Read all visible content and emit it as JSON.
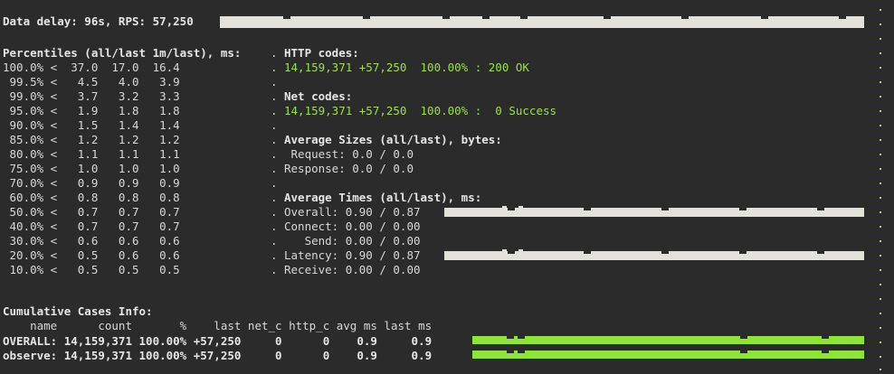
{
  "header": {
    "status_line": "Data delay: 96s, RPS: 57,250"
  },
  "percentiles": {
    "title": "Percentiles (all/last 1m/last), ms:",
    "rows": [
      "100.0% <  37.0  17.0  16.4",
      " 99.5% <   4.5   4.0   3.9",
      " 99.0% <   3.7   3.2   3.3",
      " 95.0% <   1.9   1.8   1.8",
      " 90.0% <   1.5   1.4   1.4",
      " 85.0% <   1.2   1.2   1.2",
      " 80.0% <   1.1   1.1   1.1",
      " 75.0% <   1.0   1.0   1.0",
      " 70.0% <   0.9   0.9   0.9",
      " 60.0% <   0.8   0.8   0.8",
      " 50.0% <   0.7   0.7   0.7",
      " 40.0% <   0.7   0.7   0.7",
      " 30.0% <   0.6   0.6   0.6",
      " 20.0% <   0.5   0.6   0.6",
      " 10.0% <   0.5   0.5   0.5"
    ]
  },
  "right_panel": {
    "http_title": "HTTP codes:",
    "http_line": "14,159,371 +57,250  100.00% : 200 OK",
    "net_title": "Net codes:",
    "net_line": "14,159,371 +57,250  100.00% :  0 Success",
    "sizes_title": "Average Sizes (all/last), bytes:",
    "request": " Request: 0.0 / 0.0",
    "response": "Response: 0.0 / 0.0",
    "times_title": "Average Times (all/last), ms:",
    "overall": "Overall: 0.90 / 0.87",
    "connect": "Connect: 0.00 / 0.00",
    "send": "   Send: 0.00 / 0.00",
    "latency": "Latency: 0.90 / 0.87",
    "receive": "Receive: 0.00 / 0.00"
  },
  "cases": {
    "title": "Cumulative Cases Info:",
    "header": "    name      count       %    last net_c http_c avg ms last ms",
    "rows": [
      "OVERALL: 14,159,371 100.00% +57,250     0      0    0.9     0.9",
      "observe: 14,159,371 100.00% +57,250     0      0    0.9     0.9"
    ]
  },
  "colors": {
    "background": "#2b2b2b",
    "text": "#d8d8d8",
    "ok_green": "#9be04a",
    "bar_gray": "#e3e1d9",
    "bar_green": "#8ee43a"
  }
}
